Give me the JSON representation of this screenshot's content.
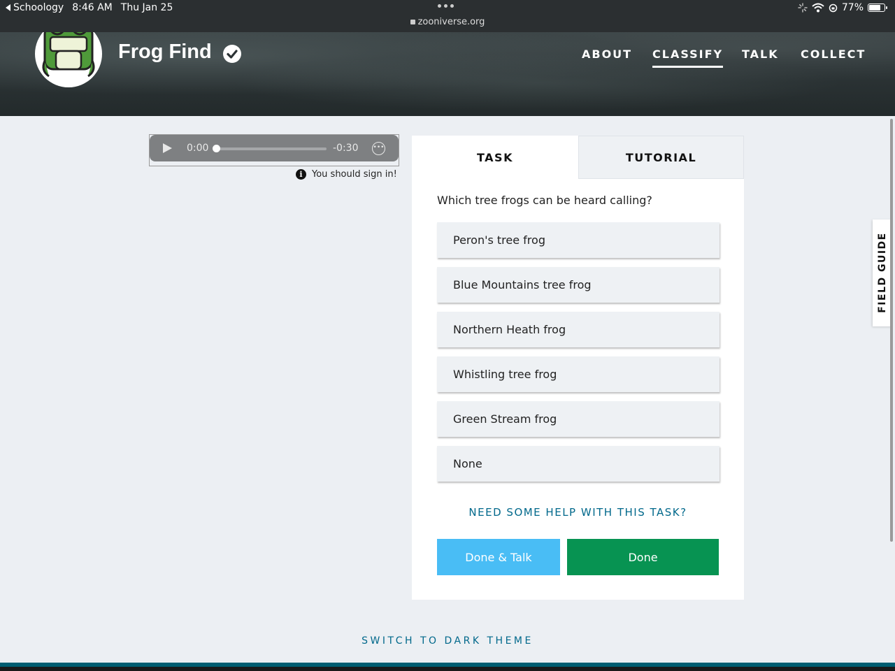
{
  "statusbar": {
    "back_app": "Schoology",
    "time": "8:46 AM",
    "date": "Thu Jan 25",
    "url": "zooniverse.org",
    "battery": "77%"
  },
  "header": {
    "project_title": "Frog Find",
    "nav": {
      "about": "ABOUT",
      "classify": "CLASSIFY",
      "talk": "TALK",
      "collect": "COLLECT"
    },
    "active_nav": "CLASSIFY"
  },
  "audio": {
    "current_time": "0:00",
    "remaining_time": "-0:30",
    "progress": 0
  },
  "notice": {
    "text": "You should sign in!"
  },
  "task_panel": {
    "tabs": {
      "task": "TASK",
      "tutorial": "TUTORIAL"
    },
    "active_tab": "TASK",
    "question": "Which tree frogs can be heard calling?",
    "answers": [
      "Peron's tree frog",
      "Blue Mountains tree frog",
      "Northern Heath frog",
      "Whistling tree frog",
      "Green Stream frog",
      "None"
    ],
    "help_link": "NEED SOME HELP WITH THIS TASK?",
    "done_talk_label": "Done & Talk",
    "done_label": "Done"
  },
  "field_guide": {
    "label": "FIELD GUIDE"
  },
  "footer": {
    "theme_toggle": "SWITCH TO DARK THEME"
  },
  "colors": {
    "page_bg": "#eceff3",
    "link": "#00688b",
    "done_talk": "#49bdf5",
    "done": "#079352",
    "answer_bg": "#eef1f4"
  }
}
